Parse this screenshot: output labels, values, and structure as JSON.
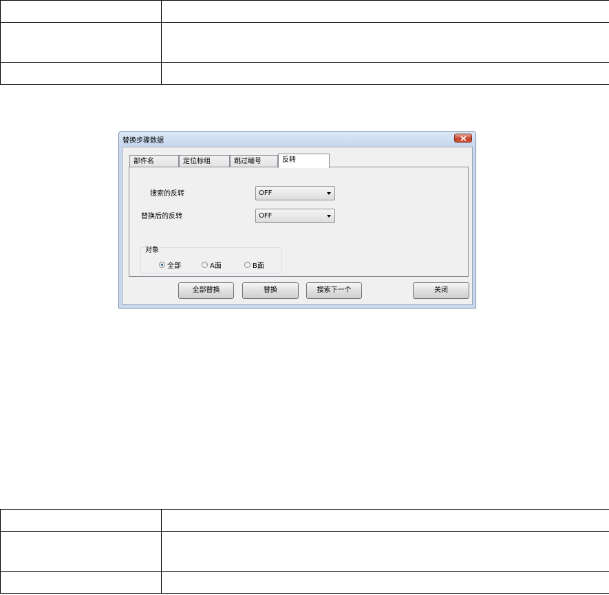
{
  "dialog": {
    "title": "替换步骤数据",
    "close_icon": "close-icon",
    "tabs": [
      {
        "label": "部件名"
      },
      {
        "label": "定位标组"
      },
      {
        "label": "跳过编号"
      },
      {
        "label": "反转",
        "active": true
      }
    ],
    "search_reverse_label": "搜索的反转",
    "search_reverse_value": "OFF",
    "replace_reverse_label": "替换后的反转",
    "replace_reverse_value": "OFF",
    "target_group_label": "对象",
    "target_options": [
      {
        "label": "全部",
        "checked": true
      },
      {
        "label": "A面",
        "checked": false
      },
      {
        "label": "B面",
        "checked": false
      }
    ],
    "buttons": {
      "replace_all": "全部替换",
      "replace": "替换",
      "search_next": "搜索下一个",
      "close": "关闭"
    }
  }
}
